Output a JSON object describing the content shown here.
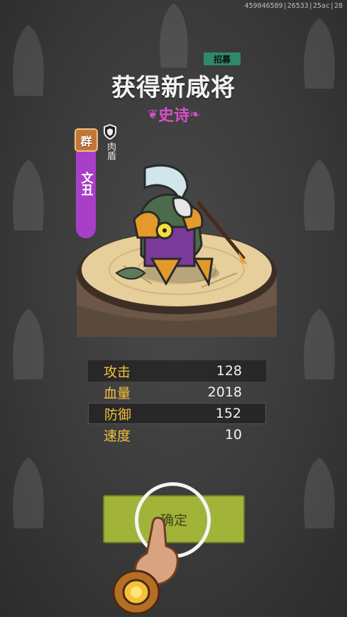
{
  "watermark": "459046589|26533|25ac|28",
  "header": {
    "badge": "招募",
    "title": "获得新咸将",
    "rarity": "史诗",
    "rarity_color": "#d64fc8"
  },
  "hero": {
    "faction": "群",
    "name": "文丑",
    "role": "肉盾",
    "role_icon": "shield-icon",
    "name_bar_color": "#a93ec7"
  },
  "stats": [
    {
      "label": "攻击",
      "value": "128"
    },
    {
      "label": "血量",
      "value": "2018"
    },
    {
      "label": "防御",
      "value": "152"
    },
    {
      "label": "速度",
      "value": "10"
    }
  ],
  "confirm_label": "确定",
  "colors": {
    "stat_label": "#f3c13d",
    "button": "#a2b33a",
    "recruit_badge": "#2f8a6b"
  }
}
